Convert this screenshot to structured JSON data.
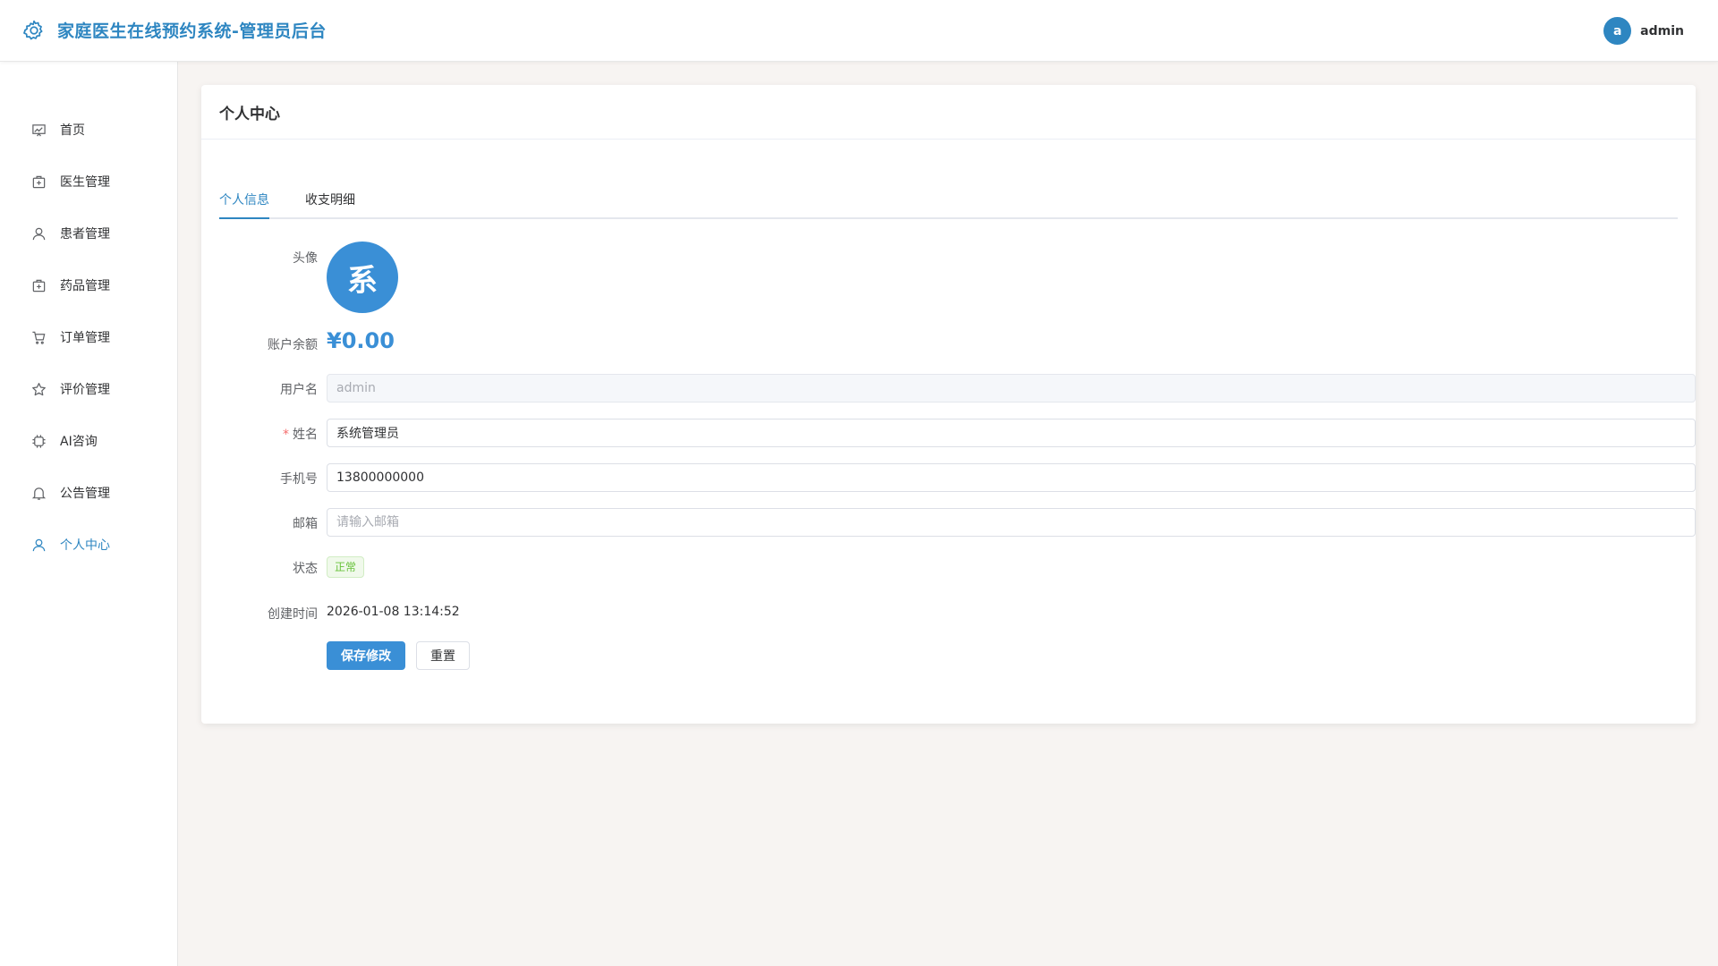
{
  "header": {
    "title": "家庭医生在线预约系统-管理员后台",
    "avatar_letter": "a",
    "username": "admin"
  },
  "sidebar": {
    "items": [
      {
        "label": "首页",
        "icon": "chart-icon"
      },
      {
        "label": "医生管理",
        "icon": "medical-box-icon"
      },
      {
        "label": "患者管理",
        "icon": "user-icon"
      },
      {
        "label": "药品管理",
        "icon": "medicine-box-icon"
      },
      {
        "label": "订单管理",
        "icon": "cart-icon"
      },
      {
        "label": "评价管理",
        "icon": "star-icon"
      },
      {
        "label": "AI咨询",
        "icon": "cpu-icon"
      },
      {
        "label": "公告管理",
        "icon": "bell-icon"
      },
      {
        "label": "个人中心",
        "icon": "user-icon"
      }
    ],
    "active_index": 8
  },
  "card": {
    "title": "个人中心"
  },
  "tabs": [
    {
      "label": "个人信息"
    },
    {
      "label": "收支明细"
    }
  ],
  "form": {
    "avatar_label": "头像",
    "avatar_char": "系",
    "balance_label": "账户余额",
    "balance_value": "¥0.00",
    "username_label": "用户名",
    "username_value": "admin",
    "name_label": "姓名",
    "name_value": "系统管理员",
    "phone_label": "手机号",
    "phone_value": "13800000000",
    "email_label": "邮箱",
    "email_placeholder": "请输入邮箱",
    "status_label": "状态",
    "status_value": "正常",
    "created_label": "创建时间",
    "created_value": "2026-01-08 13:14:52",
    "save_label": "保存修改",
    "reset_label": "重置"
  },
  "colors": {
    "primary": "#3a8fd6",
    "title": "#2e86c1",
    "success": "#67c23a",
    "background": "#f7f4f2"
  }
}
